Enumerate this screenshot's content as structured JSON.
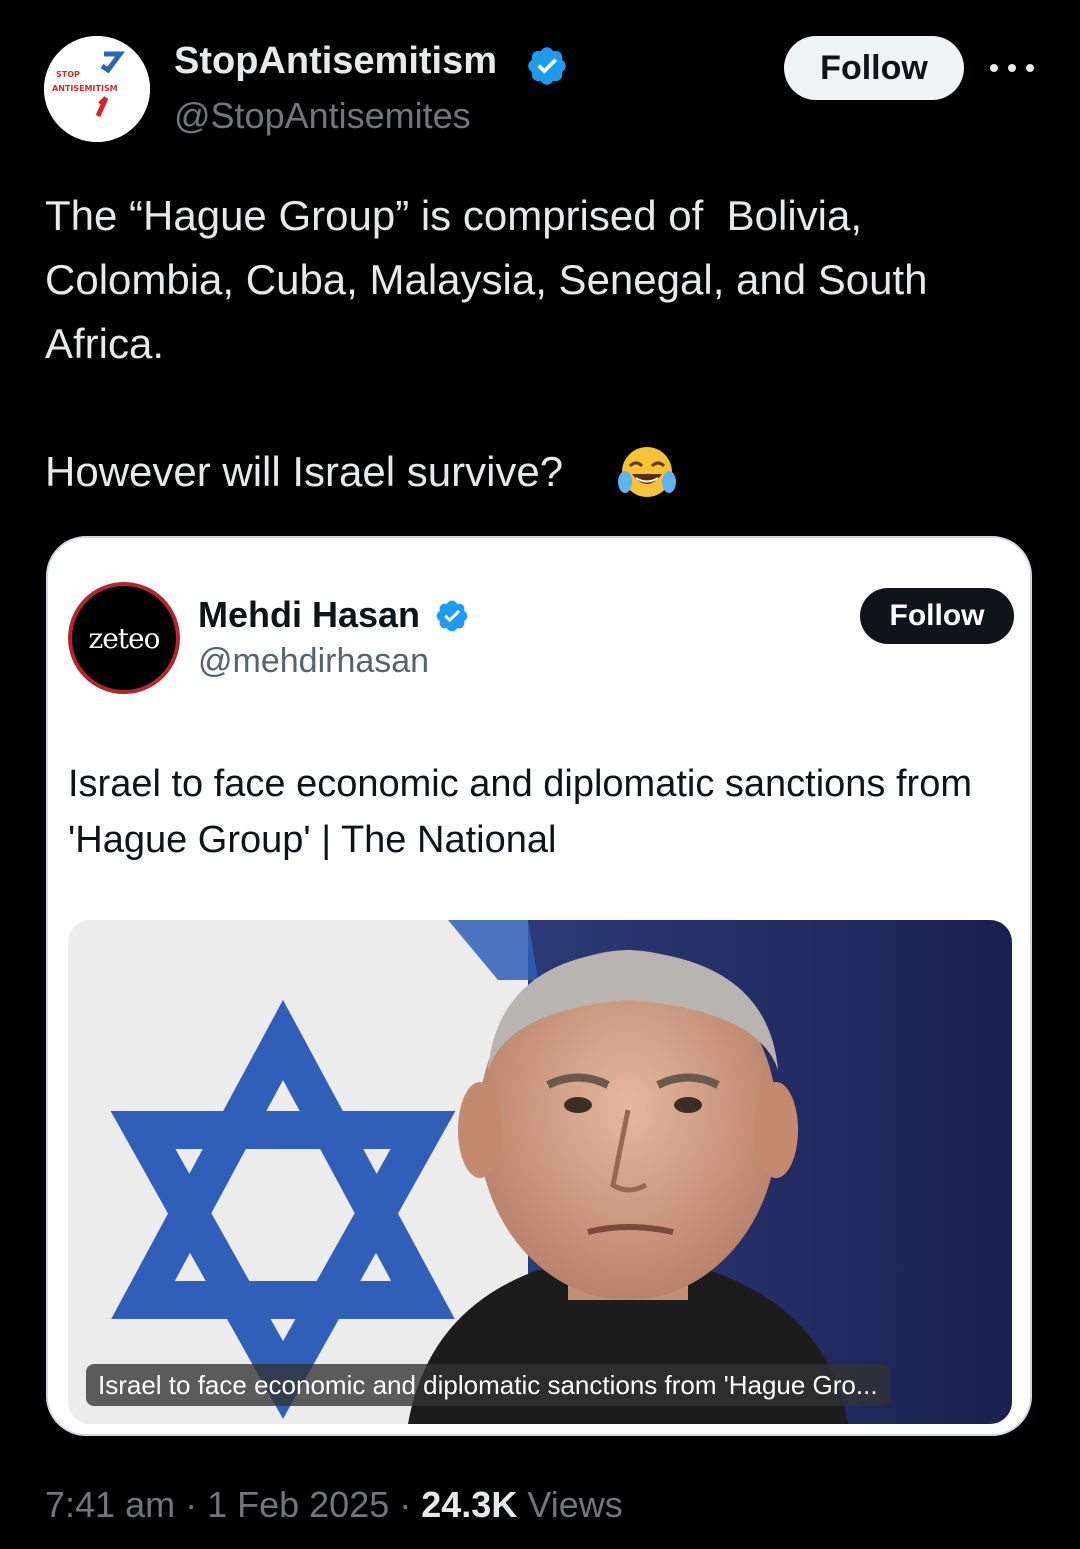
{
  "author": {
    "display_name": "StopAntisemitism",
    "handle": "@StopAntisemites",
    "avatar_text_top": "STOP",
    "avatar_text_bottom": "ANTISEMITISM"
  },
  "follow_label": "Follow",
  "tweet": {
    "text_line1": "The “Hague Group” is comprised of  Bolivia, Colombia, Cuba, Malaysia, Senegal, and South Africa.",
    "text_line2": "However will Israel survive?",
    "emoji": "face-with-tears-of-joy"
  },
  "quoted": {
    "avatar_text": "zeteo",
    "display_name": "Mehdi Hasan",
    "handle": "@mehdirhasan",
    "follow_label": "Follow",
    "text": "Israel to face economic and diplomatic sanctions from 'Hague Group' | The National",
    "image_caption": "Israel to face economic and diplomatic sanctions from 'Hague Gro..."
  },
  "footer": {
    "time": "7:41 am",
    "date": "1 Feb 2025",
    "views_count": "24.3K",
    "views_label": "Views"
  },
  "colors": {
    "background": "#000000",
    "verified_blue": "#1d9bf0",
    "secondary_text": "#71767b",
    "flag_blue": "#2f5fb8"
  }
}
